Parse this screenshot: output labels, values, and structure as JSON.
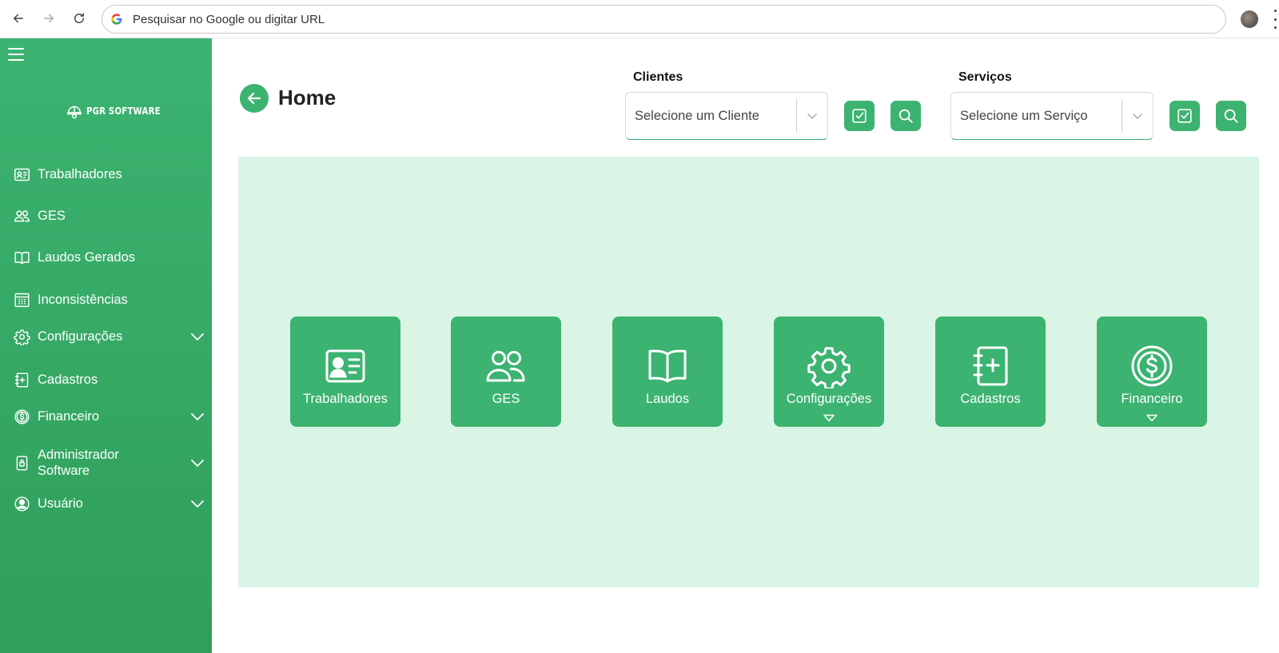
{
  "browser": {
    "address_bar_text": "Pesquisar no Google ou digitar URL"
  },
  "sidebar": {
    "logo_text": "PGR SOFTWARE",
    "items": [
      {
        "label": "Trabalhadores",
        "icon": "id-card-icon",
        "expandable": false
      },
      {
        "label": "GES",
        "icon": "people-icon",
        "expandable": false
      },
      {
        "label": "Laudos Gerados",
        "icon": "book-icon",
        "expandable": false
      },
      {
        "label": "Inconsistências",
        "icon": "calendar-grid-icon",
        "expandable": false
      },
      {
        "label": "Configurações",
        "icon": "gear-icon",
        "expandable": true
      },
      {
        "label": "Cadastros",
        "icon": "notebook-plus-icon",
        "expandable": false
      },
      {
        "label": "Financeiro",
        "icon": "dollar-circle-icon",
        "expandable": true
      },
      {
        "label": "Administrador Software",
        "icon": "lock-icon",
        "expandable": true
      },
      {
        "label": "Usuário",
        "icon": "user-circle-icon",
        "expandable": true
      }
    ]
  },
  "main": {
    "title": "Home",
    "filters": {
      "clientes": {
        "label": "Clientes",
        "placeholder": "Selecione um Cliente"
      },
      "servicos": {
        "label": "Serviços",
        "placeholder": "Selecione um Serviço"
      }
    },
    "tiles": [
      {
        "label": "Trabalhadores",
        "icon": "id-card-icon",
        "has_caret": false
      },
      {
        "label": "GES",
        "icon": "people-icon",
        "has_caret": false
      },
      {
        "label": "Laudos",
        "icon": "book-icon",
        "has_caret": false
      },
      {
        "label": "Configurações",
        "icon": "gear-icon",
        "has_caret": true
      },
      {
        "label": "Cadastros",
        "icon": "notebook-plus-icon",
        "has_caret": false
      },
      {
        "label": "Financeiro",
        "icon": "dollar-circle-icon",
        "has_caret": true
      }
    ]
  },
  "colors": {
    "brand_green": "#3cb371",
    "panel_background": "#daf5e6"
  }
}
